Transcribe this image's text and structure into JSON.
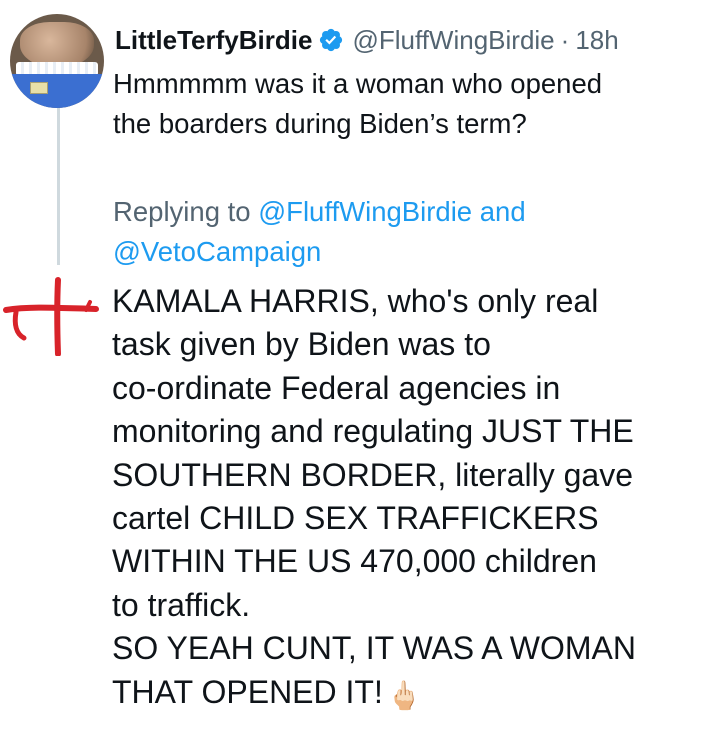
{
  "parent_tweet": {
    "display_name": "LittleTerfyBirdie",
    "handle": "@FluffWingBirdie",
    "separator": "·",
    "time": "18h",
    "text_lines": [
      "Hmmmmm was it a woman who opened",
      "the boarders during Biden’s term?"
    ]
  },
  "reply": {
    "replying_prefix": "Replying to",
    "mention_1": "@FluffWingBirdie",
    "and": "and",
    "mention_2": "@VetoCampaign",
    "text_lines": [
      "KAMALA HARRIS, who's only real",
      "task given by Biden was to",
      "co-ordinate Federal agencies in",
      "monitoring and regulating JUST THE",
      "SOUTHERN BORDER, literally gave",
      "cartel CHILD SEX TRAFFICKERS",
      "WITHIN THE US 470,000 children",
      "to traffick.",
      "SO YEAH CUNT, IT WAS A WOMAN",
      "THAT OPENED IT!"
    ],
    "end_emoji": "🖕🏻"
  },
  "icons": {
    "verified": "verified-badge-icon",
    "flag": "st-george-cross-icon"
  },
  "colors": {
    "text": "#0f1419",
    "secondary": "#536471",
    "link": "#1d9bf0",
    "verified": "#1d9bf0",
    "cross": "#d8232a",
    "thread_line": "#cfd9de"
  }
}
